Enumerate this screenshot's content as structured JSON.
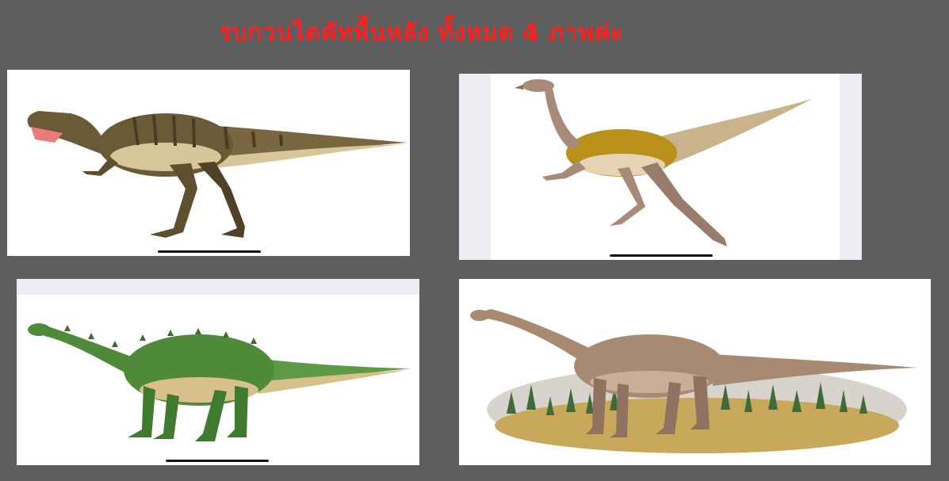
{
  "page": {
    "title": "รบกวนไดคัทพื้นหลัง ทั้งหมด 4 ภาพค่ะ",
    "background_color": "#5e5e5e",
    "title_color": "#ff1f1f"
  },
  "images": [
    {
      "subject": "theropod-dinosaur",
      "colors": [
        "#6b5a36",
        "#d9c59a",
        "#e87c7c"
      ]
    },
    {
      "subject": "ornithomimid-dinosaur",
      "colors": [
        "#b8901a",
        "#a88a7a"
      ]
    },
    {
      "subject": "sauropodomorph-dinosaur",
      "colors": [
        "#4f8a3a",
        "#d7c08c"
      ]
    },
    {
      "subject": "sauropod-dinosaur-with-landscape",
      "colors": [
        "#a88a72",
        "#c8a85a",
        "#3f6b3a"
      ]
    }
  ]
}
